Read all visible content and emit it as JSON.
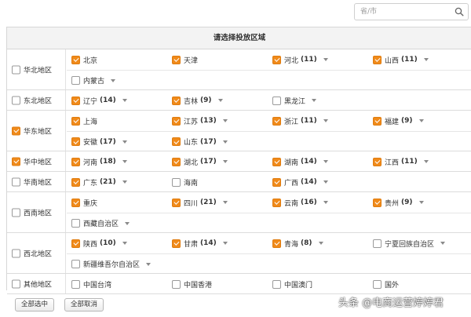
{
  "search": {
    "placeholder": "省/市",
    "value": ""
  },
  "panel": {
    "title": "请选择投放区域"
  },
  "accent_color": "#f08a1a",
  "regions": [
    {
      "name": "华北地区",
      "checked": false,
      "rows": [
        [
          {
            "name": "北京",
            "checked": true,
            "count": "",
            "dropdown": false
          },
          {
            "name": "天津",
            "checked": true,
            "count": "",
            "dropdown": false
          },
          {
            "name": "河北",
            "checked": true,
            "count": "(11)",
            "dropdown": true
          },
          {
            "name": "山西",
            "checked": true,
            "count": "(11)",
            "dropdown": true
          }
        ],
        [
          {
            "name": "内蒙古",
            "checked": false,
            "count": "",
            "dropdown": true
          }
        ]
      ]
    },
    {
      "name": "东北地区",
      "checked": false,
      "rows": [
        [
          {
            "name": "辽宁",
            "checked": true,
            "count": "(14)",
            "dropdown": true
          },
          {
            "name": "吉林",
            "checked": true,
            "count": "(9)",
            "dropdown": true
          },
          {
            "name": "黑龙江",
            "checked": false,
            "count": "",
            "dropdown": true
          }
        ]
      ]
    },
    {
      "name": "华东地区",
      "checked": true,
      "rows": [
        [
          {
            "name": "上海",
            "checked": true,
            "count": "",
            "dropdown": false
          },
          {
            "name": "江苏",
            "checked": true,
            "count": "(13)",
            "dropdown": true
          },
          {
            "name": "浙江",
            "checked": true,
            "count": "(11)",
            "dropdown": true
          },
          {
            "name": "福建",
            "checked": true,
            "count": "(9)",
            "dropdown": true
          }
        ],
        [
          {
            "name": "安徽",
            "checked": true,
            "count": "(17)",
            "dropdown": true
          },
          {
            "name": "山东",
            "checked": true,
            "count": "(17)",
            "dropdown": true
          }
        ]
      ]
    },
    {
      "name": "华中地区",
      "checked": true,
      "rows": [
        [
          {
            "name": "河南",
            "checked": true,
            "count": "(18)",
            "dropdown": true
          },
          {
            "name": "湖北",
            "checked": true,
            "count": "(17)",
            "dropdown": true
          },
          {
            "name": "湖南",
            "checked": true,
            "count": "(14)",
            "dropdown": true
          },
          {
            "name": "江西",
            "checked": true,
            "count": "(11)",
            "dropdown": true
          }
        ]
      ]
    },
    {
      "name": "华南地区",
      "checked": false,
      "rows": [
        [
          {
            "name": "广东",
            "checked": true,
            "count": "(21)",
            "dropdown": true
          },
          {
            "name": "海南",
            "checked": false,
            "count": "",
            "dropdown": false
          },
          {
            "name": "广西",
            "checked": true,
            "count": "(14)",
            "dropdown": true
          }
        ]
      ]
    },
    {
      "name": "西南地区",
      "checked": false,
      "rows": [
        [
          {
            "name": "重庆",
            "checked": true,
            "count": "",
            "dropdown": false
          },
          {
            "name": "四川",
            "checked": true,
            "count": "(21)",
            "dropdown": true
          },
          {
            "name": "云南",
            "checked": true,
            "count": "(16)",
            "dropdown": true
          },
          {
            "name": "贵州",
            "checked": true,
            "count": "(9)",
            "dropdown": true
          }
        ],
        [
          {
            "name": "西藏自治区",
            "checked": false,
            "count": "",
            "dropdown": true
          }
        ]
      ]
    },
    {
      "name": "西北地区",
      "checked": false,
      "rows": [
        [
          {
            "name": "陕西",
            "checked": true,
            "count": "(10)",
            "dropdown": true
          },
          {
            "name": "甘肃",
            "checked": true,
            "count": "(14)",
            "dropdown": true
          },
          {
            "name": "青海",
            "checked": true,
            "count": "(8)",
            "dropdown": true
          },
          {
            "name": "宁夏回族自治区",
            "checked": false,
            "count": "",
            "dropdown": true
          }
        ],
        [
          {
            "name": "新疆维吾尔自治区",
            "checked": false,
            "count": "",
            "dropdown": true
          }
        ]
      ]
    },
    {
      "name": "其他地区",
      "checked": false,
      "rows": [
        [
          {
            "name": "中国台湾",
            "checked": false,
            "count": "",
            "dropdown": false
          },
          {
            "name": "中国香港",
            "checked": false,
            "count": "",
            "dropdown": false
          },
          {
            "name": "中国澳门",
            "checked": false,
            "count": "",
            "dropdown": false
          },
          {
            "name": "国外",
            "checked": false,
            "count": "",
            "dropdown": false
          }
        ]
      ]
    }
  ],
  "actions": {
    "select_all": "全部选中",
    "deselect_all": "全部取消"
  },
  "watermark": "头条 @电商运营婷婷君"
}
